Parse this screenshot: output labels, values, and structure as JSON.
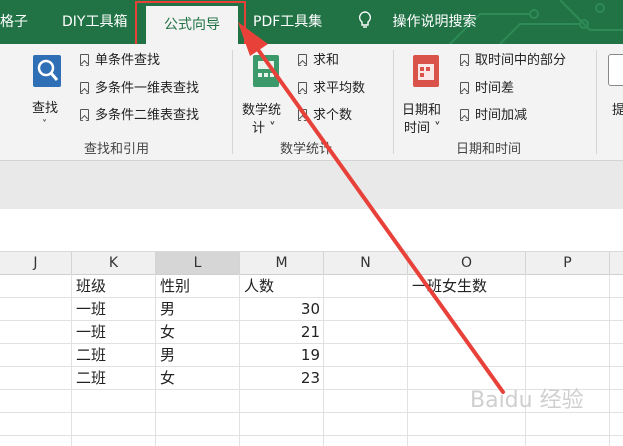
{
  "tabs": [
    {
      "label": "格子"
    },
    {
      "label": "DIY工具箱"
    },
    {
      "label": "公式向导"
    },
    {
      "label": "PDF工具集"
    },
    {
      "label": "操作说明搜索"
    }
  ],
  "groups": {
    "lookup": {
      "label": "查找和引用",
      "big_button": {
        "label": "查找",
        "icon": "search-icon"
      },
      "items": [
        "单条件查找",
        "多条件一维表查找",
        "多条件二维表查找"
      ]
    },
    "stats": {
      "label": "数学统计",
      "big_button": {
        "label_line1": "数学统",
        "label_line2": "计 ˅",
        "icon": "math-stats-icon"
      },
      "items": [
        "求和",
        "求平均数",
        "求个数"
      ]
    },
    "datetime": {
      "label": "日期和时间",
      "big_button": {
        "label_line1": "日期和",
        "label_line2": "时间 ˅",
        "icon": "calendar-icon"
      },
      "items": [
        "取时间中的部分",
        "时间差",
        "时间加减"
      ]
    },
    "partial": {
      "label_line1": "提"
    }
  },
  "grid": {
    "columns": [
      "J",
      "K",
      "L",
      "M",
      "N",
      "O",
      "P"
    ],
    "selected_column": "L",
    "headers": {
      "class": "班级",
      "gender": "性别",
      "count": "人数"
    },
    "rows": [
      {
        "class": "一班",
        "gender": "男",
        "count": "30"
      },
      {
        "class": "一班",
        "gender": "女",
        "count": "21"
      },
      {
        "class": "二班",
        "gender": "男",
        "count": "19"
      },
      {
        "class": "二班",
        "gender": "女",
        "count": "23"
      }
    ],
    "o_label": "一班女生数"
  },
  "watermark": "Baidu 经验",
  "colors": {
    "ribbon_green": "#217346",
    "highlight_red": "#e8413a"
  }
}
